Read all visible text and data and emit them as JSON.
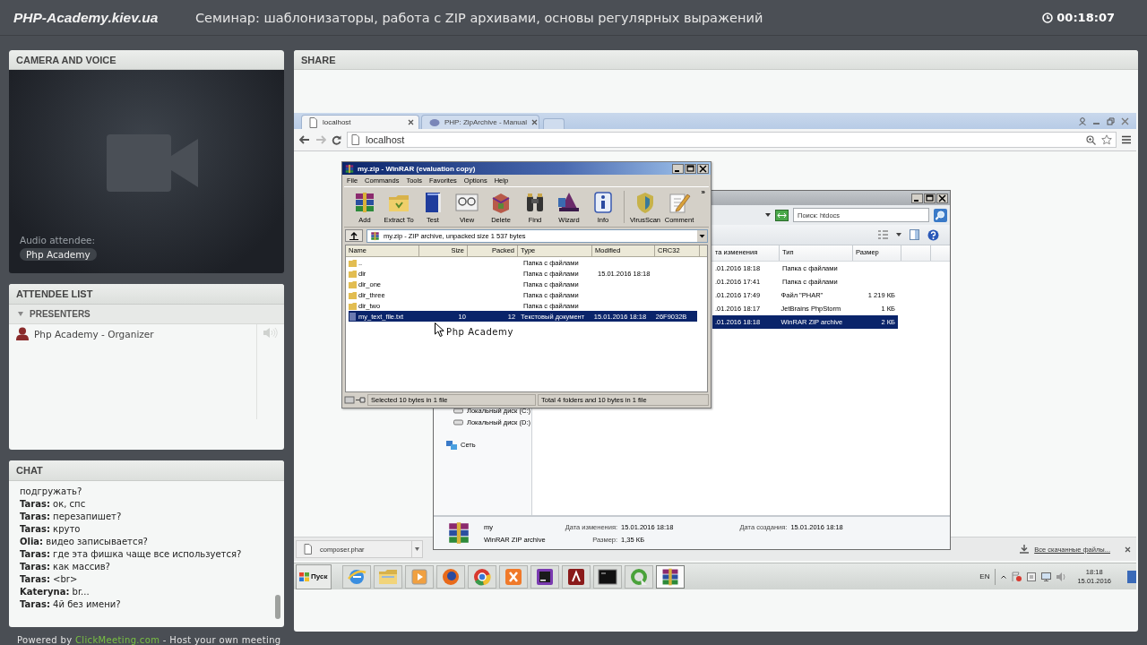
{
  "header": {
    "logo": "PHP-Academy.kiev.ua",
    "title": "Семинар: шаблонизаторы, работа с ZIP архивами, основы регулярных выражений",
    "timer": "00:18:07"
  },
  "camera_panel": {
    "title": "CAMERA AND VOICE",
    "audio_label": "Audio attendee:",
    "attendee": "Php Academy"
  },
  "attendee_panel": {
    "title": "ATTENDEE LIST",
    "groups": [
      {
        "name": "PRESENTERS",
        "expanded": true,
        "attendees": [
          {
            "name": "Php Academy - Organizer"
          }
        ]
      }
    ]
  },
  "chat_panel": {
    "title": "CHAT",
    "messages": [
      {
        "text": "подгружать?"
      },
      {
        "author": "Taras:",
        "text": "ок, спс"
      },
      {
        "author": "Taras:",
        "text": "перезапишет?"
      },
      {
        "author": "Taras:",
        "text": "круто"
      },
      {
        "author": "Olia:",
        "text": "видео записывается?"
      },
      {
        "author": "Taras:",
        "text": "где эта фишка чаще все используется?"
      },
      {
        "author": "Taras:",
        "text": "как массив?"
      },
      {
        "author": "Taras:",
        "text": "<br>"
      },
      {
        "author": "Kateryna:",
        "text": "br..."
      },
      {
        "author": "Taras:",
        "text": "4й без имени?"
      }
    ]
  },
  "footer": {
    "before": "Powered by ",
    "link": "ClickMeeting.com",
    "after": " - Host your own meeting"
  },
  "share_panel": {
    "title": "SHARE",
    "browser": {
      "tabs": [
        {
          "label": "localhost",
          "selected": true
        },
        {
          "label": "PHP: ZipArchive - Manual",
          "selected": false
        }
      ],
      "address": "localhost",
      "download": {
        "file": "composer.phar",
        "all_link": "Все скачанные файлы..."
      }
    },
    "winrar": {
      "title": "my.zip - WinRAR (evaluation copy)",
      "menu": [
        "File",
        "Commands",
        "Tools",
        "Favorites",
        "Options",
        "Help"
      ],
      "tools": [
        "Add",
        "Extract To",
        "Test",
        "View",
        "Delete",
        "Find",
        "Wizard",
        "Info",
        "VirusScan",
        "Comment"
      ],
      "more": "»",
      "path": "my.zip - ZIP archive, unpacked size 1 537 bytes",
      "columns": [
        "Name",
        "Size",
        "Packed",
        "Type",
        "Modified",
        "CRC32"
      ],
      "rows": [
        {
          "kind": "folder",
          "name": "..",
          "type": "Папка с файлами",
          "selected": false
        },
        {
          "kind": "folder",
          "name": "dir",
          "type": "Папка с файлами",
          "modified": "15.01.2016 18:18",
          "selected": false
        },
        {
          "kind": "folder",
          "name": "dir_one",
          "type": "Папка с файлами",
          "selected": false
        },
        {
          "kind": "folder",
          "name": "dir_three",
          "type": "Папка с файлами",
          "selected": false
        },
        {
          "kind": "folder",
          "name": "dir_two",
          "type": "Папка с файлами",
          "selected": false
        },
        {
          "kind": "file",
          "name": "my_text_file.txt",
          "size": "10",
          "packed": "12",
          "type": "Текстовый документ",
          "modified": "15.01.2016 18:18",
          "crc": "26F9032B",
          "selected": true
        }
      ],
      "status_left": "Selected 10 bytes in 1 file",
      "status_right": "Total 4 folders and 10 bytes in 1 file"
    },
    "cursor_label": "Php Academy",
    "explorer": {
      "search_placeholder": "Поиск: htdocs",
      "columns": [
        "та изменения",
        "Тип",
        "Размер"
      ],
      "rows": [
        {
          "modified": ".01.2016 18:18",
          "type": "Папка с файлами",
          "selected": false
        },
        {
          "modified": ".01.2016 17:41",
          "type": "Папка с файлами",
          "selected": false
        },
        {
          "modified": ".01.2016 17:49",
          "type": "Файл \"PHAR\"",
          "size": "1 219 КБ",
          "selected": false
        },
        {
          "modified": ".01.2016 18:17",
          "type": "JetBrains PhpStorm",
          "size": "1 КБ",
          "selected": false
        },
        {
          "modified": ".01.2016 18:18",
          "type": "WinRAR ZIP archive",
          "size": "2 КБ",
          "selected": true
        }
      ],
      "nav": [
        {
          "kind": "drive",
          "label": "Локальный диск (C:)"
        },
        {
          "kind": "drive",
          "label": "Локальный диск (D:)"
        },
        {
          "kind": "network",
          "label": "Сеть"
        }
      ],
      "details": {
        "name": "my",
        "type": "WinRAR ZIP archive",
        "fields": [
          {
            "label": "Дата изменения:",
            "value": "15.01.2016 18:18"
          },
          {
            "label": "Дата создания:",
            "value": "15.01.2016 18:18"
          },
          {
            "label": "Размер:",
            "value": "1,35 КБ"
          }
        ]
      }
    },
    "taskbar": {
      "start": "Пуск",
      "apps": [
        {
          "selected": false
        },
        {
          "selected": false
        },
        {
          "selected": false
        },
        {
          "selected": false
        },
        {
          "selected": false
        },
        {
          "selected": false
        },
        {
          "selected": false
        },
        {
          "selected": false
        },
        {
          "selected": false
        },
        {
          "selected": false
        },
        {
          "selected": true
        }
      ],
      "language": "EN",
      "time": "18:18",
      "date": "15.01.2016"
    }
  }
}
